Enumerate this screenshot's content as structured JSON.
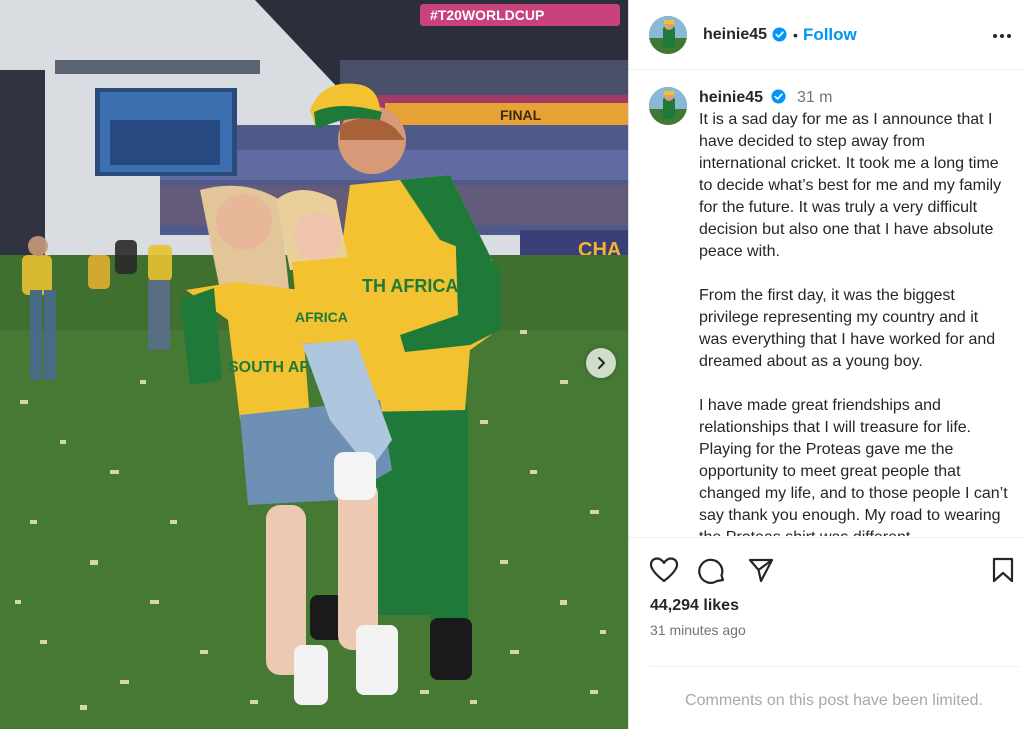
{
  "post": {
    "username": "heinie45",
    "follow_label": "Follow",
    "dot": "•",
    "time": "31 m",
    "caption_paragraphs": [
      "It is a sad day for me as I announce that I have decided to step away from international cricket. It took me a long time to decide what’s best for me and my family for the future. It was truly a very difficult decision but also one that I have absolute peace with.",
      "From the first day, it was the biggest privilege representing my country and it was everything that I have worked for and dreamed about as a young boy.",
      "I have made great friendships and relationships that I will treasure for life. Playing for the Proteas gave me the opportunity to meet great people that changed my life, and to those people I can’t say thank you enough. My road to wearing the Proteas shirt was different"
    ],
    "likes": "44,294 likes",
    "posted_ago": "31 minutes ago",
    "comments_limited": "Comments on this post have been limited."
  },
  "photo": {
    "stadium_banner": "#T20WORLDCUP",
    "final_banner": "FINAL",
    "champions_banner": "CHA",
    "jersey_text": "TH AFRICA",
    "jersey_text_woman": "SOUTH AFR",
    "jersey_text_child": "AFRICA"
  },
  "icons": {
    "verified": "verified-badge-icon",
    "more": "more-options-icon",
    "like": "heart-icon",
    "comment": "comment-bubble-icon",
    "share": "share-paper-plane-icon",
    "save": "bookmark-icon",
    "next": "chevron-right-icon"
  },
  "colors": {
    "accent": "#0095f6",
    "text": "#262626",
    "muted": "#737373",
    "limited": "#a8a8a8",
    "jersey_yellow": "#f2c230",
    "jersey_green": "#1f7a3a"
  }
}
